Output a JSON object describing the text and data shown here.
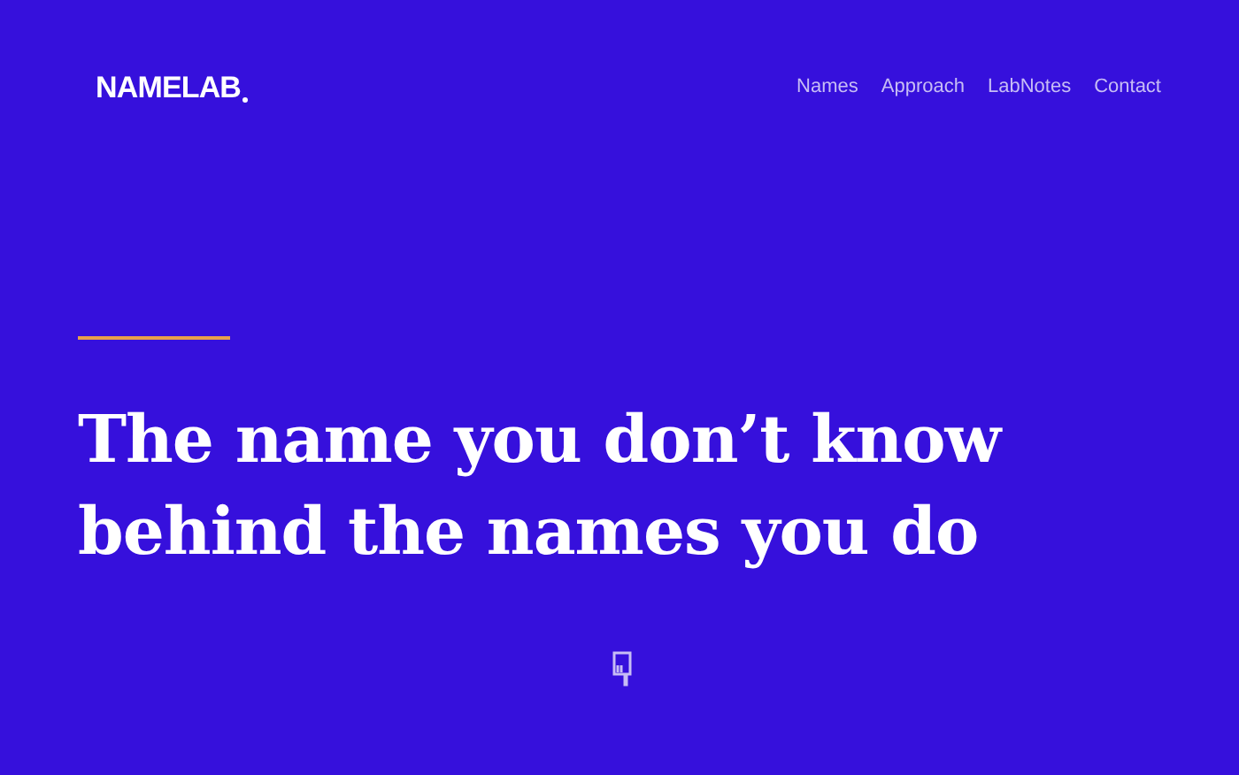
{
  "logo": "NAMELAB",
  "nav": [
    "Names",
    "Approach",
    "LabNotes",
    "Contact"
  ],
  "headline": [
    "The name you don’t know",
    "behind the names you do"
  ]
}
